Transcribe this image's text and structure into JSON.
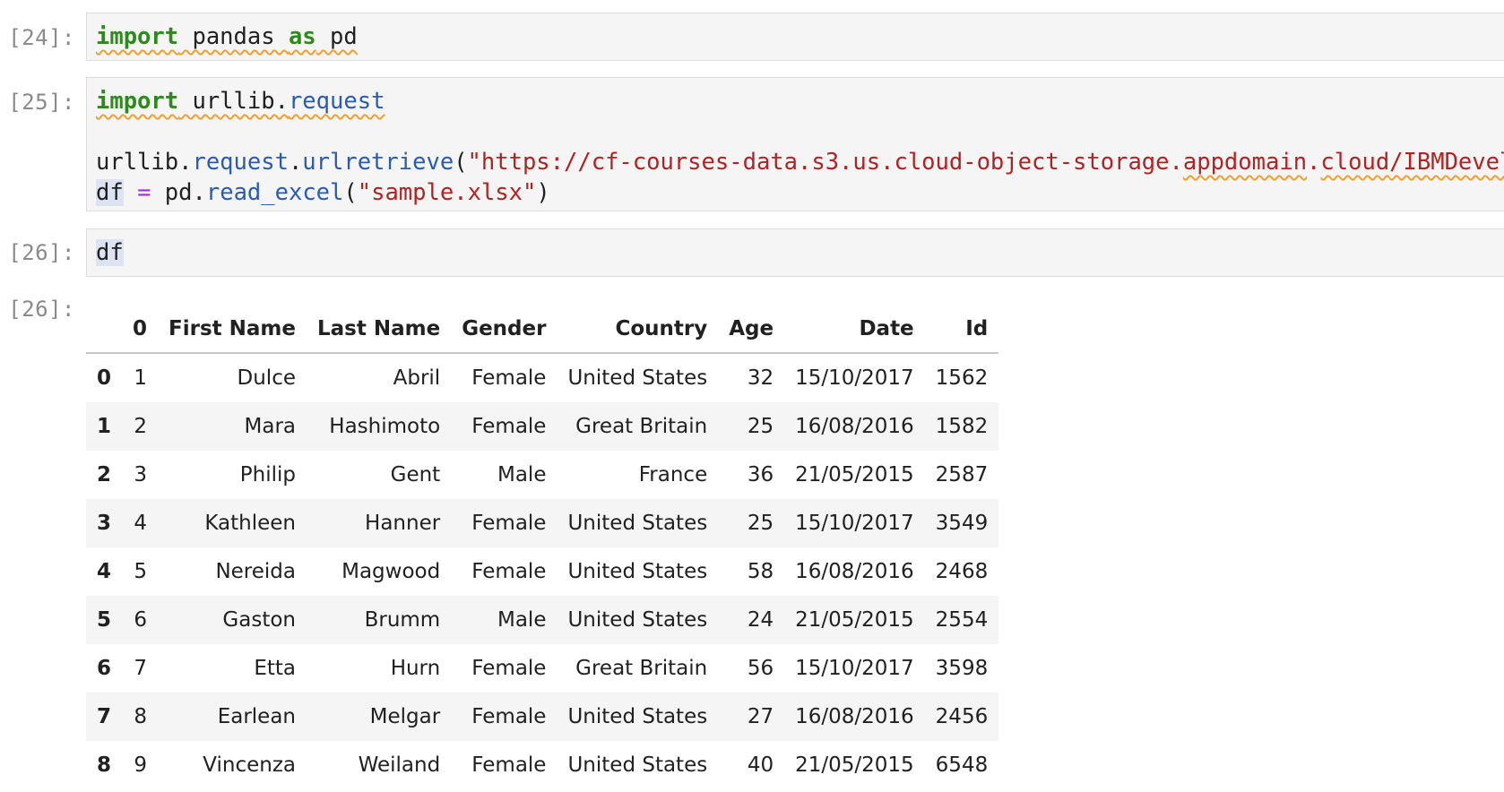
{
  "cells": [
    {
      "prompt": "[24]:",
      "lines": [
        [
          {
            "t": "import",
            "c": "kw",
            "sq": true
          },
          {
            "t": " pandas ",
            "c": "",
            "sq": true
          },
          {
            "t": "as",
            "c": "kw",
            "sq": true
          },
          {
            "t": " pd",
            "c": "",
            "sq": true
          }
        ]
      ]
    },
    {
      "prompt": "[25]:",
      "lines": [
        [
          {
            "t": "import",
            "c": "kw",
            "sq": true
          },
          {
            "t": " urllib.",
            "c": "",
            "sq": true
          },
          {
            "t": "request",
            "c": "attr",
            "sq": true
          }
        ],
        [],
        [
          {
            "t": "urllib.",
            "c": ""
          },
          {
            "t": "request",
            "c": "attr"
          },
          {
            "t": ".",
            "c": ""
          },
          {
            "t": "urlretrieve",
            "c": "attr"
          },
          {
            "t": "(",
            "c": ""
          },
          {
            "t": "\"https://cf-courses-data.s3.us.cloud-object-storage.",
            "c": "str"
          },
          {
            "t": "appdomain",
            "c": "str",
            "sq": true
          },
          {
            "t": ".",
            "c": "str"
          },
          {
            "t": "cloud",
            "c": "str",
            "sq": true
          },
          {
            "t": "/IBMDeveloperSkillsNetwork",
            "c": "str",
            "sq": true
          }
        ],
        [
          {
            "t": "df",
            "c": "",
            "hl": true
          },
          {
            "t": " ",
            "c": ""
          },
          {
            "t": "=",
            "c": "op"
          },
          {
            "t": " pd.",
            "c": ""
          },
          {
            "t": "read_excel",
            "c": "attr"
          },
          {
            "t": "(",
            "c": ""
          },
          {
            "t": "\"sample.xlsx\"",
            "c": "str"
          },
          {
            "t": ")",
            "c": ""
          }
        ]
      ]
    },
    {
      "prompt": "[26]:",
      "lines": [
        [
          {
            "t": "df",
            "c": "",
            "hl": true
          }
        ]
      ]
    }
  ],
  "output": {
    "prompt": "[26]:",
    "columns": [
      "",
      "0",
      "First Name",
      "Last Name",
      "Gender",
      "Country",
      "Age",
      "Date",
      "Id"
    ],
    "rows": [
      [
        "0",
        "1",
        "Dulce",
        "Abril",
        "Female",
        "United States",
        "32",
        "15/10/2017",
        "1562"
      ],
      [
        "1",
        "2",
        "Mara",
        "Hashimoto",
        "Female",
        "Great Britain",
        "25",
        "16/08/2016",
        "1582"
      ],
      [
        "2",
        "3",
        "Philip",
        "Gent",
        "Male",
        "France",
        "36",
        "21/05/2015",
        "2587"
      ],
      [
        "3",
        "4",
        "Kathleen",
        "Hanner",
        "Female",
        "United States",
        "25",
        "15/10/2017",
        "3549"
      ],
      [
        "4",
        "5",
        "Nereida",
        "Magwood",
        "Female",
        "United States",
        "58",
        "16/08/2016",
        "2468"
      ],
      [
        "5",
        "6",
        "Gaston",
        "Brumm",
        "Male",
        "United States",
        "24",
        "21/05/2015",
        "2554"
      ],
      [
        "6",
        "7",
        "Etta",
        "Hurn",
        "Female",
        "Great Britain",
        "56",
        "15/10/2017",
        "3598"
      ],
      [
        "7",
        "8",
        "Earlean",
        "Melgar",
        "Female",
        "United States",
        "27",
        "16/08/2016",
        "2456"
      ],
      [
        "8",
        "9",
        "Vincenza",
        "Weiland",
        "Female",
        "United States",
        "40",
        "21/05/2015",
        "6548"
      ]
    ]
  }
}
